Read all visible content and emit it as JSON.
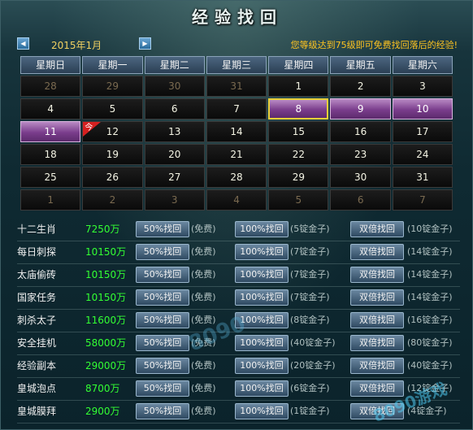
{
  "window": {
    "title": "经验找回"
  },
  "calendar": {
    "month_label": "2015年1月",
    "notice": "您等级达到75级即可免费找回落后的经验!",
    "weekdays": [
      "星期日",
      "星期一",
      "星期二",
      "星期三",
      "星期四",
      "星期五",
      "星期六"
    ],
    "weeks": [
      [
        {
          "d": "28",
          "state": "other"
        },
        {
          "d": "29",
          "state": "other"
        },
        {
          "d": "30",
          "state": "other"
        },
        {
          "d": "31",
          "state": "other"
        },
        {
          "d": "1",
          "state": "normal"
        },
        {
          "d": "2",
          "state": "normal"
        },
        {
          "d": "3",
          "state": "normal"
        }
      ],
      [
        {
          "d": "4",
          "state": "normal"
        },
        {
          "d": "5",
          "state": "normal"
        },
        {
          "d": "6",
          "state": "normal"
        },
        {
          "d": "7",
          "state": "normal"
        },
        {
          "d": "8",
          "state": "done-selected"
        },
        {
          "d": "9",
          "state": "done"
        },
        {
          "d": "10",
          "state": "done"
        }
      ],
      [
        {
          "d": "11",
          "state": "done"
        },
        {
          "d": "12",
          "state": "today"
        },
        {
          "d": "13",
          "state": "normal"
        },
        {
          "d": "14",
          "state": "normal"
        },
        {
          "d": "15",
          "state": "normal"
        },
        {
          "d": "16",
          "state": "normal"
        },
        {
          "d": "17",
          "state": "normal"
        }
      ],
      [
        {
          "d": "18",
          "state": "normal"
        },
        {
          "d": "19",
          "state": "normal"
        },
        {
          "d": "20",
          "state": "normal"
        },
        {
          "d": "21",
          "state": "normal"
        },
        {
          "d": "22",
          "state": "normal"
        },
        {
          "d": "23",
          "state": "normal"
        },
        {
          "d": "24",
          "state": "normal"
        }
      ],
      [
        {
          "d": "25",
          "state": "normal"
        },
        {
          "d": "26",
          "state": "normal"
        },
        {
          "d": "27",
          "state": "normal"
        },
        {
          "d": "28",
          "state": "normal"
        },
        {
          "d": "29",
          "state": "normal"
        },
        {
          "d": "30",
          "state": "normal"
        },
        {
          "d": "31",
          "state": "normal"
        }
      ],
      [
        {
          "d": "1",
          "state": "other"
        },
        {
          "d": "2",
          "state": "other"
        },
        {
          "d": "3",
          "state": "other"
        },
        {
          "d": "4",
          "state": "other"
        },
        {
          "d": "5",
          "state": "other"
        },
        {
          "d": "6",
          "state": "other"
        },
        {
          "d": "7",
          "state": "other"
        }
      ]
    ],
    "today_marker": "今"
  },
  "tasks": [
    {
      "name": "十二生肖",
      "exp": "7250万",
      "b50": "50%找回",
      "c50": "(免费)",
      "b100": "100%找回",
      "c100": "(5锭金子)",
      "bdbl": "双倍找回",
      "cdbl": "(10锭金子)"
    },
    {
      "name": "每日刺探",
      "exp": "10150万",
      "b50": "50%找回",
      "c50": "(免费)",
      "b100": "100%找回",
      "c100": "(7锭金子)",
      "bdbl": "双倍找回",
      "cdbl": "(14锭金子)"
    },
    {
      "name": "太庙偷砖",
      "exp": "10150万",
      "b50": "50%找回",
      "c50": "(免费)",
      "b100": "100%找回",
      "c100": "(7锭金子)",
      "bdbl": "双倍找回",
      "cdbl": "(14锭金子)"
    },
    {
      "name": "国家任务",
      "exp": "10150万",
      "b50": "50%找回",
      "c50": "(免费)",
      "b100": "100%找回",
      "c100": "(7锭金子)",
      "bdbl": "双倍找回",
      "cdbl": "(14锭金子)"
    },
    {
      "name": "刺杀太子",
      "exp": "11600万",
      "b50": "50%找回",
      "c50": "(免费)",
      "b100": "100%找回",
      "c100": "(8锭金子)",
      "bdbl": "双倍找回",
      "cdbl": "(16锭金子)"
    },
    {
      "name": "安全挂机",
      "exp": "58000万",
      "b50": "50%找回",
      "c50": "(免费)",
      "b100": "100%找回",
      "c100": "(40锭金子)",
      "bdbl": "双倍找回",
      "cdbl": "(80锭金子)"
    },
    {
      "name": "经验副本",
      "exp": "29000万",
      "b50": "50%找回",
      "c50": "(免费)",
      "b100": "100%找回",
      "c100": "(20锭金子)",
      "bdbl": "双倍找回",
      "cdbl": "(40锭金子)"
    },
    {
      "name": "皇城泡点",
      "exp": "8700万",
      "b50": "50%找回",
      "c50": "(免费)",
      "b100": "100%找回",
      "c100": "(6锭金子)",
      "bdbl": "双倍找回",
      "cdbl": "(12锭金子)"
    },
    {
      "name": "皇城膜拜",
      "exp": "2900万",
      "b50": "50%找回",
      "c50": "(免费)",
      "b100": "100%找回",
      "c100": "(1锭金子)",
      "bdbl": "双倍找回",
      "cdbl": "(4锭金子)"
    }
  ],
  "watermark": {
    "text1": "8090",
    "text2": "8090游戏"
  },
  "colors": {
    "exp_value": "#33ff33",
    "notice": "#ffc420",
    "done_day": "#7a3d8c",
    "today_flag": "#d42020",
    "selected_border": "#e8d038"
  }
}
